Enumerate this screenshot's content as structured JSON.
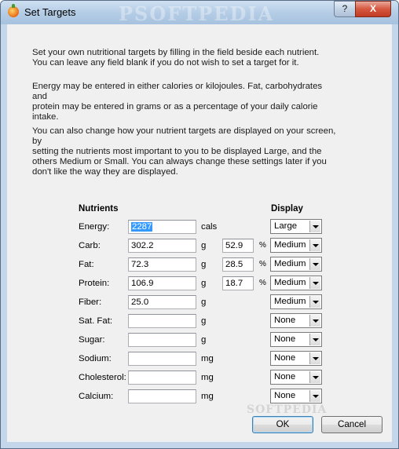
{
  "window": {
    "title": "Set Targets",
    "help_label": "?",
    "close_label": "X",
    "watermark": "PSOFTPEDIA"
  },
  "intro": {
    "p1": "Set your own nutritional targets by filling in the field beside each nutrient.\nYou can leave any field blank if you do not wish to set a target for it.",
    "p2": "Energy may be entered in either calories or kilojoules. Fat, carbohydrates and\nprotein may be entered in grams or as a percentage of your daily calorie\nintake.",
    "p3": "You can also change how your nutrient targets are displayed on your screen, by\nsetting the nutrients most important to you to be displayed Large, and the\nothers Medium or Small. You can always change these settings later if you\ndon't like the way they are displayed."
  },
  "table": {
    "nutrients_header": "Nutrients",
    "display_header": "Display",
    "percent_symbol": "%",
    "rows": [
      {
        "name": "Energy:",
        "value": "2287",
        "unit": "cals",
        "percent": null,
        "display": "Large"
      },
      {
        "name": "Carb:",
        "value": "302.2",
        "unit": "g",
        "percent": "52.9",
        "display": "Medium"
      },
      {
        "name": "Fat:",
        "value": "72.3",
        "unit": "g",
        "percent": "28.5",
        "display": "Medium"
      },
      {
        "name": "Protein:",
        "value": "106.9",
        "unit": "g",
        "percent": "18.7",
        "display": "Medium"
      },
      {
        "name": "Fiber:",
        "value": "25.0",
        "unit": "g",
        "percent": null,
        "display": "Medium"
      },
      {
        "name": "Sat. Fat:",
        "value": "",
        "unit": "g",
        "percent": null,
        "display": "None"
      },
      {
        "name": "Sugar:",
        "value": "",
        "unit": "g",
        "percent": null,
        "display": "None"
      },
      {
        "name": "Sodium:",
        "value": "",
        "unit": "mg",
        "percent": null,
        "display": "None"
      },
      {
        "name": "Cholesterol:",
        "value": "",
        "unit": "mg",
        "percent": null,
        "display": "None"
      },
      {
        "name": "Calcium:",
        "value": "",
        "unit": "mg",
        "percent": null,
        "display": "None"
      }
    ]
  },
  "buttons": {
    "ok": "OK",
    "cancel": "Cancel"
  },
  "watermark_bottom": "SOFTPEDIA",
  "colors": {
    "selection": "#3399ff",
    "dialog_bg": "#f0f0f0",
    "titlebar": "#b5cde6"
  }
}
